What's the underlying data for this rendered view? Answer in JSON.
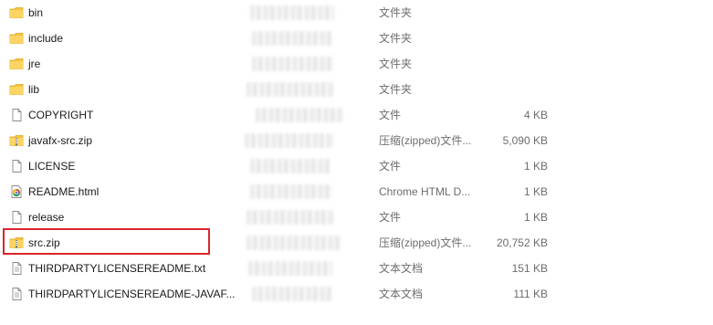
{
  "files": [
    {
      "name": "bin",
      "type": "文件夹",
      "size": "",
      "icon": "folder-icon"
    },
    {
      "name": "include",
      "type": "文件夹",
      "size": "",
      "icon": "folder-icon"
    },
    {
      "name": "jre",
      "type": "文件夹",
      "size": "",
      "icon": "folder-icon"
    },
    {
      "name": "lib",
      "type": "文件夹",
      "size": "",
      "icon": "folder-icon"
    },
    {
      "name": "COPYRIGHT",
      "type": "文件",
      "size": "4 KB",
      "icon": "file-icon"
    },
    {
      "name": "javafx-src.zip",
      "type": "压缩(zipped)文件...",
      "size": "5,090 KB",
      "icon": "zip-folder-icon"
    },
    {
      "name": "LICENSE",
      "type": "文件",
      "size": "1 KB",
      "icon": "file-icon"
    },
    {
      "name": "README.html",
      "type": "Chrome HTML D...",
      "size": "1 KB",
      "icon": "chrome-html-icon"
    },
    {
      "name": "release",
      "type": "文件",
      "size": "1 KB",
      "icon": "file-icon"
    },
    {
      "name": "src.zip",
      "type": "压缩(zipped)文件...",
      "size": "20,752 KB",
      "icon": "zip-folder-icon"
    },
    {
      "name": "THIRDPARTYLICENSEREADME.txt",
      "type": "文本文档",
      "size": "151 KB",
      "icon": "text-file-icon"
    },
    {
      "name": "THIRDPARTYLICENSEREADME-JAVAF...",
      "type": "文本文档",
      "size": "111 KB",
      "icon": "text-file-icon"
    }
  ],
  "highlight": {
    "color": "#d9252d"
  }
}
